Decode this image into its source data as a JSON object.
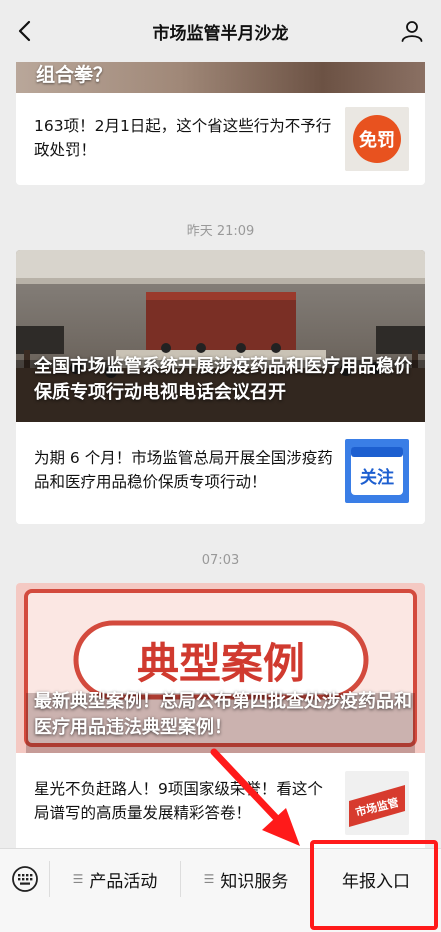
{
  "header": {
    "title": "市场监管半月沙龙"
  },
  "feed": {
    "card1": {
      "banner_text": "组合拳？",
      "sub_text": "163项！2月1日起，这个省这些行为不予行政处罚！",
      "thumb_text": "免罚"
    },
    "time2": "昨天 21:09",
    "card2": {
      "hero_text": "全国市场监管系统开展涉疫药品和医疗用品稳价保质专项行动电视电话会议召开",
      "sub_text": "为期 6 个月！市场监管总局开展全国涉疫药品和医疗用品稳价保质专项行动！",
      "thumb_text": "关注"
    },
    "time3": "07:03",
    "card3": {
      "hero_badge": "典型案例",
      "hero_text": "最新典型案例！总局公布第四批查处涉疫药品和医疗用品违法典型案例！",
      "sub_text": "星光不负赶路人！9项国家级荣誉！看这个局谱写的高质量发展精彩答卷！",
      "thumb_text": "市场监管"
    }
  },
  "menu": {
    "item1": "产品活动",
    "item2": "知识服务",
    "item3": "年报入口"
  }
}
